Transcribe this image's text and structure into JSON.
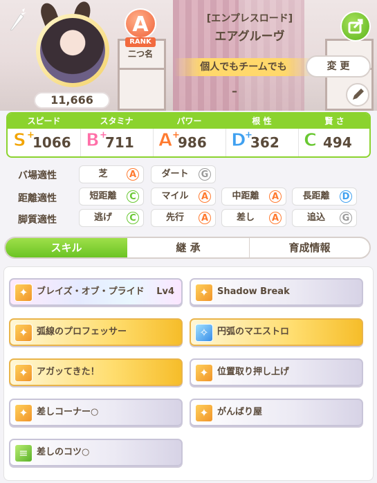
{
  "profile": {
    "fans": "11,666",
    "rank_letter": "A",
    "rank_word": "RANK",
    "rank_sub": "二つ名",
    "title_bracket": "[エンプレスロード]",
    "name": "エアグルーヴ",
    "motto": "個人でもチームでも",
    "change_label": "変 更",
    "comment": "–"
  },
  "stats": [
    {
      "label": "スピード",
      "grade": "S",
      "plus": "+",
      "value": "1066",
      "color": "#f2a400"
    },
    {
      "label": "スタミナ",
      "grade": "B",
      "plus": "+",
      "value": "711",
      "color": "#ff6fa8"
    },
    {
      "label": "パワー",
      "grade": "A",
      "plus": "+",
      "value": "986",
      "color": "#ff7a2f"
    },
    {
      "label": "根 性",
      "grade": "D",
      "plus": "+",
      "value": "362",
      "color": "#3fa0f0"
    },
    {
      "label": "賢 さ",
      "grade": "C",
      "plus": "",
      "value": "494",
      "color": "#69c832"
    }
  ],
  "aptitude": {
    "track_label": "バ場適性",
    "distance_label": "距離適性",
    "style_label": "脚質適性",
    "track": [
      {
        "name": "芝",
        "grade": "A"
      },
      {
        "name": "ダート",
        "grade": "G"
      }
    ],
    "distance": [
      {
        "name": "短距離",
        "grade": "C"
      },
      {
        "name": "マイル",
        "grade": "A"
      },
      {
        "name": "中距離",
        "grade": "A"
      },
      {
        "name": "長距離",
        "grade": "D"
      }
    ],
    "style": [
      {
        "name": "逃げ",
        "grade": "C"
      },
      {
        "name": "先行",
        "grade": "A"
      },
      {
        "name": "差し",
        "grade": "A"
      },
      {
        "name": "追込",
        "grade": "G"
      }
    ]
  },
  "tabs": [
    "スキル",
    "継 承",
    "育成情報"
  ],
  "skills": [
    {
      "name": "ブレイズ・オブ・プライド",
      "level": "Lv4",
      "type": "rainbow",
      "icon": "orange-runner-icon"
    },
    {
      "name": "Shadow Break",
      "level": "",
      "type": "white",
      "icon": "orange-runner-icon"
    },
    {
      "name": "弧線のプロフェッサー",
      "level": "",
      "type": "gold",
      "icon": "orange-runner-icon"
    },
    {
      "name": "円弧のマエストロ",
      "level": "",
      "type": "gold",
      "icon": "blue-sparkle-icon"
    },
    {
      "name": "アガッてきた！",
      "level": "",
      "type": "gold",
      "icon": "orange-runner-icon"
    },
    {
      "name": "位置取り押し上げ",
      "level": "",
      "type": "white",
      "icon": "orange-runner-icon"
    },
    {
      "name": "差しコーナー○",
      "level": "",
      "type": "white",
      "icon": "orange-runner-icon"
    },
    {
      "name": "がんばり屋",
      "level": "",
      "type": "white",
      "icon": "orange-runner-icon"
    },
    {
      "name": "差しのコツ○",
      "level": "",
      "type": "white",
      "icon": "green-book-icon"
    }
  ],
  "grade_colors": {
    "A": "#ff7a2f",
    "C": "#69c832",
    "D": "#3fa0f0",
    "G": "#9a9a9a"
  }
}
